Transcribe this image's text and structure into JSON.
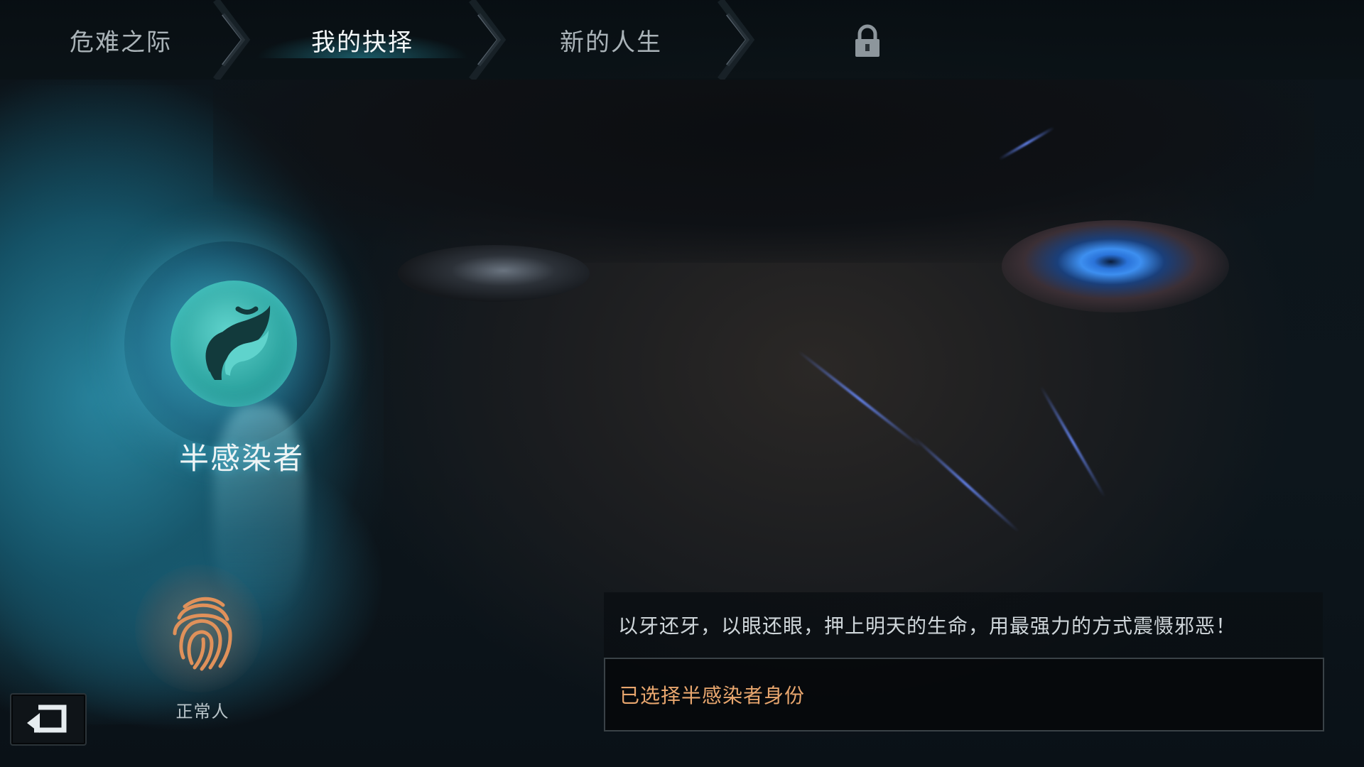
{
  "nav": {
    "steps": [
      {
        "label": "危难之际",
        "active": false
      },
      {
        "label": "我的抉择",
        "active": true
      },
      {
        "label": "新的人生",
        "active": false
      }
    ],
    "locked_icon": "lock-icon"
  },
  "choices": {
    "selected": {
      "label": "半感染者",
      "icon": "feather-emblem-icon"
    },
    "other": {
      "label": "正常人",
      "icon": "fingerprint-icon"
    }
  },
  "panel": {
    "description": "以牙还牙，以眼还眼，押上明天的生命，用最强力的方式震慑邪恶！",
    "status": "已选择半感染者身份"
  },
  "back_button": {
    "icon": "back-arrow-icon"
  },
  "colors": {
    "accent_cyan": "#3fb6c2",
    "status_orange": "#e8a66e",
    "eye_blue": "#3d8ff0"
  }
}
